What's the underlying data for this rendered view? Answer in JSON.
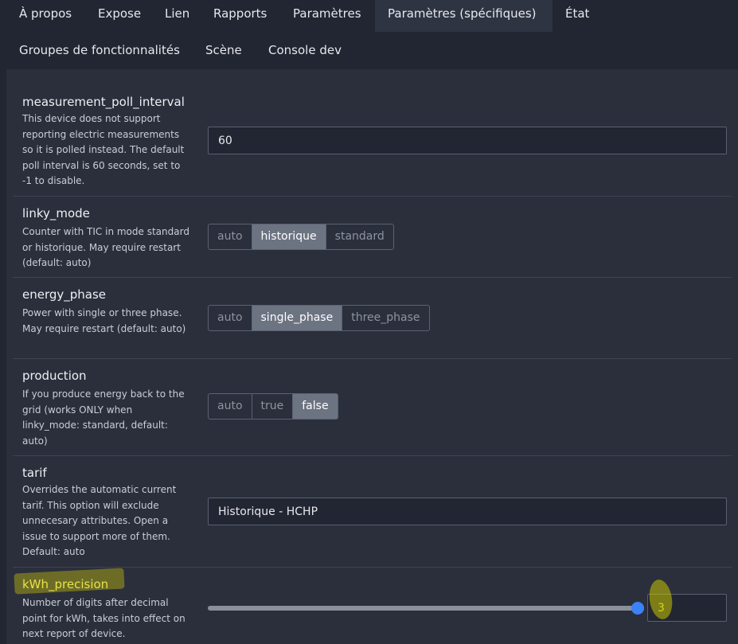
{
  "tabs": [
    {
      "label": "À propos"
    },
    {
      "label": "Expose"
    },
    {
      "label": "Lien"
    },
    {
      "label": "Rapports"
    },
    {
      "label": "Paramètres"
    },
    {
      "label": "Paramètres (spécifiques)",
      "active": true
    },
    {
      "label": "État"
    },
    {
      "label": "Groupes de fonctionnalités"
    },
    {
      "label": "Scène"
    },
    {
      "label": "Console dev"
    }
  ],
  "settings": {
    "measurement_poll_interval": {
      "label": "measurement_poll_interval",
      "description": "This device does not support reporting electric measurements so it is polled instead. The default poll interval is 60 seconds, set to -1 to disable.",
      "value": "60"
    },
    "linky_mode": {
      "label": "linky_mode",
      "description": "Counter with TIC in mode standard or historique. May require restart (default: auto)",
      "options": [
        "auto",
        "historique",
        "standard"
      ],
      "selected": "historique"
    },
    "energy_phase": {
      "label": "energy_phase",
      "description": "Power with single or three phase. May require restart (default: auto)",
      "options": [
        "auto",
        "single_phase",
        "three_phase"
      ],
      "selected": "single_phase"
    },
    "production": {
      "label": "production",
      "description": "If you produce energy back to the grid (works ONLY when linky_mode: standard, default: auto)",
      "options": [
        "auto",
        "true",
        "false"
      ],
      "selected": "false"
    },
    "tarif": {
      "label": "tarif",
      "description": "Overrides the automatic current tarif. This option will exclude unnecesary attributes. Open a issue to support more of them. Default: auto",
      "value": "Historique - HCHP"
    },
    "kWh_precision": {
      "label": "kWh_precision",
      "description": "Number of digits after decimal point for kWh, takes into effect on next report of device.",
      "value": "3",
      "slider_fraction": 1.0
    }
  },
  "colors": {
    "background": "#222632",
    "card": "#2b2f3c",
    "active_tab": "#2f3443",
    "selected_option": "#6c7381",
    "slider_thumb": "#3b82f6",
    "highlight": "#e8e000"
  }
}
